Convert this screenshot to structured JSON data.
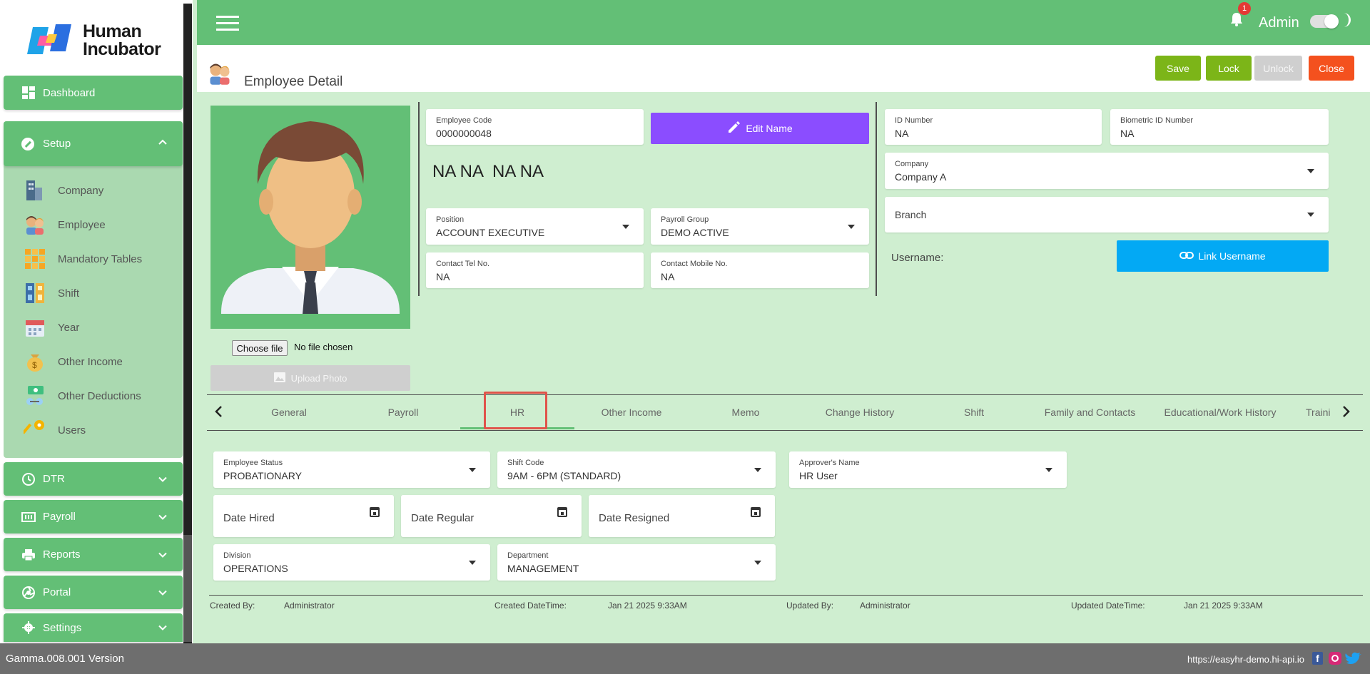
{
  "brand": {
    "line1": "Human",
    "line2": "Incubator"
  },
  "sidebar": {
    "dashboard": "Dashboard",
    "setup": "Setup",
    "setup_items": [
      "Company",
      "Employee",
      "Mandatory Tables",
      "Shift",
      "Year",
      "Other Income",
      "Other Deductions",
      "Users"
    ],
    "sections": [
      "DTR",
      "Payroll",
      "Reports",
      "Portal",
      "Settings"
    ]
  },
  "topbar": {
    "notification_count": "1",
    "user": "Admin"
  },
  "page": {
    "title": "Employee Detail"
  },
  "actions": {
    "save": "Save",
    "lock": "Lock",
    "unlock": "Unlock",
    "close": "Close"
  },
  "photo": {
    "choose_file": "Choose file",
    "no_file": "No file chosen",
    "upload": "Upload Photo"
  },
  "employee": {
    "code_label": "Employee Code",
    "code": "0000000048",
    "edit_name": "Edit Name",
    "full_name": "NA NA  NA NA",
    "position_label": "Position",
    "position": "ACCOUNT EXECUTIVE",
    "payroll_group_label": "Payroll Group",
    "payroll_group": "DEMO ACTIVE",
    "tel_label": "Contact Tel No.",
    "tel": "NA",
    "mobile_label": "Contact Mobile No.",
    "mobile": "NA",
    "id_label": "ID Number",
    "id": "NA",
    "bio_label": "Biometric ID Number",
    "bio": "NA",
    "company_label": "Company",
    "company": "Company A",
    "branch_placeholder": "Branch",
    "username_label": "Username:",
    "link_username": "Link Username"
  },
  "tabs": [
    "General",
    "Payroll",
    "HR",
    "Other Income",
    "Memo",
    "Change History",
    "Shift",
    "Family and Contacts",
    "Educational/Work History",
    "Traini"
  ],
  "active_tab": "HR",
  "hr": {
    "status_label": "Employee Status",
    "status": "PROBATIONARY",
    "shift_label": "Shift Code",
    "shift": "9AM - 6PM (STANDARD)",
    "approver_label": "Approver's Name",
    "approver": "HR User",
    "date_hired": "Date Hired",
    "date_regular": "Date Regular",
    "date_resigned": "Date Resigned",
    "division_label": "Division",
    "division": "OPERATIONS",
    "department_label": "Department",
    "department": "MANAGEMENT"
  },
  "meta": {
    "created_by_label": "Created By:",
    "created_by": "Administrator",
    "created_dt_label": "Created DateTime:",
    "created_dt": "Jan 21 2025 9:33AM",
    "updated_by_label": "Updated By:",
    "updated_by": "Administrator",
    "updated_dt_label": "Updated DateTime:",
    "updated_dt": "Jan 21 2025 9:33AM"
  },
  "footer": {
    "version": "Gamma.008.001 Version",
    "url": "https://easyhr-demo.hi-api.io"
  },
  "colors": {
    "green": "#63bf76",
    "purple": "#8b4dff",
    "blue": "#03a9f4",
    "red": "#f4511e",
    "lime": "#7cb518"
  }
}
